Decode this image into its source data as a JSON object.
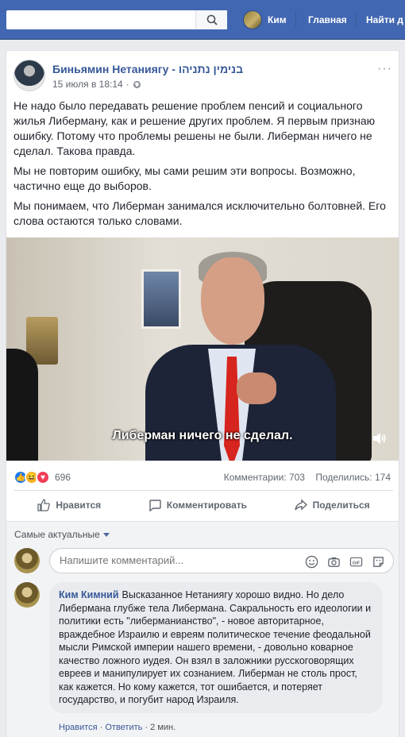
{
  "topbar": {
    "search_placeholder": "",
    "profile_name": "Ким",
    "home_link": "Главная",
    "find_link": "Найти д"
  },
  "post": {
    "page_name": "Биньямин Нетаниягу - בנימין נתניהו",
    "timestamp": "15 июля в 18:14",
    "paragraphs": [
      "Не надо было передавать решение проблем пенсий и социального жилья Либерману, как и решение других проблем. Я первым признаю ошибку. Потому что проблемы решены не были. Либерман ничего не сделал. Такова правда.",
      "Мы не повторим ошибку, мы сами решим эти вопросы. Возможно, частично еще до выборов.",
      "Мы понимаем, что Либерман занимался исключительно болтовней. Его слова остаются только словами."
    ],
    "video_subtitle": "Либерман ничего не сделал.",
    "reaction_count": "696",
    "comments_stat": "Комментарии: 703",
    "shares_stat": "Поделились: 174",
    "actions": {
      "like": "Нравится",
      "comment": "Комментировать",
      "share": "Поделиться"
    }
  },
  "comments": {
    "sort_label": "Самые актуальные",
    "input_placeholder": "Напишите комментарий...",
    "items": [
      {
        "author": "Ким Кимний",
        "text": "Высказанное Нетаниягу хорошо видно. Но дело Либермана глубже тела Либермана. Сакральность его идеологии и политики есть \"либерманианство\", - новое авторитарное, враждебное Израилю и евреям политическое течение феодальной мысли Римской империи нашего времени, - довольно коварное качество ложного иудея. Он взял в заложники русскоговорящих евреев и манипулирует их сознанием. Либерман не столь прост, как кажется. Но кому кажется, тот ошибается, и потеряет государство, и погубит народ Израиля.",
        "like": "Нравится",
        "reply": "Ответить",
        "time": "2 мин.",
        "dot": "·"
      }
    ]
  },
  "colors": {
    "topbar": "#4267b2",
    "link": "#365899",
    "like_blue": "#1877f2",
    "love_red": "#f33e58",
    "haha_yellow": "#f7b125"
  }
}
